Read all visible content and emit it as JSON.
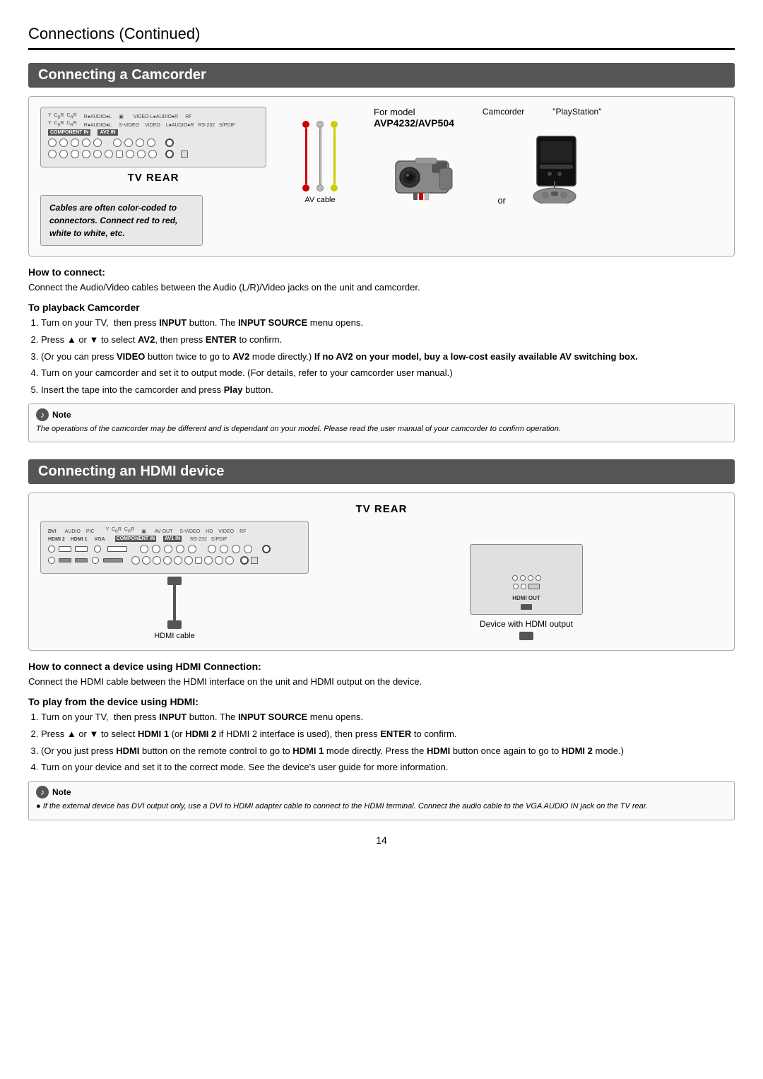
{
  "page": {
    "header": {
      "title": "Connections",
      "subtitle": " (Continued)"
    },
    "page_number": "14"
  },
  "section1": {
    "title": "Connecting a Camcorder",
    "tv_rear_label": "TV REAR",
    "for_model_label": "For model",
    "model_numbers": "AVP4232/AVP504",
    "camcorder_label": "Camcorder",
    "playstation_label": "\"PlayStation\"",
    "or_label": "or",
    "av_cable_label": "AV cable",
    "italic_box_text": "Cables are often color-coded to connectors. Connect red to red, white to white, etc.",
    "how_to_connect_title": "How to connect:",
    "how_to_connect_text": "Connect the Audio/Video cables between the Audio (L/R)/Video jacks on the unit and camcorder.",
    "playback_title": "To playback Camcorder",
    "playback_steps": [
      "Turn on your TV,  then press INPUT button. The INPUT SOURCE menu opens.",
      "Press ▲ or ▼ to select AV2, then press ENTER to confirm.",
      "(Or you can press VIDEO button twice to go to AV2 mode directly.) If no AV2 on your model, buy a low-cost easily available AV switching box.",
      "Turn on your camcorder and set it to output mode. (For details, refer to your camcorder user manual.)",
      "Insert the tape into the camcorder and press Play button."
    ],
    "note_text": "The operations of the camcorder may be different and is dependant on your model. Please read the user manual of your camcorder to confirm operation."
  },
  "section2": {
    "title": "Connecting an HDMI device",
    "tv_rear_label": "TV REAR",
    "hdmi_cable_label": "HDMI cable",
    "device_label": "Device with HDMI output",
    "how_to_connect_title": "How to connect a device using HDMI Connection:",
    "how_to_connect_text": "Connect the HDMI cable between the HDMI interface on the unit and HDMI output on the device.",
    "play_title": "To play from the device using HDMI:",
    "play_steps": [
      "Turn on your TV,  then press INPUT button. The INPUT SOURCE menu opens.",
      "Press ▲ or ▼ to select HDMI 1 (or HDMI 2 if HDMI 2 interface is used), then press ENTER to confirm.",
      "(Or you just press HDMI button on the remote control to go to HDMI 1 mode directly. Press the HDMI button once again to go to HDMI 2 mode.)",
      "Turn on your device and set it to the correct mode. See the device's user guide for more information."
    ],
    "note_text": "● If the external device has DVI output only, use a DVI to HDMI adapter cable to connect to the HDMI terminal. Connect the audio cable to the VGA AUDIO IN jack on the TV rear."
  }
}
